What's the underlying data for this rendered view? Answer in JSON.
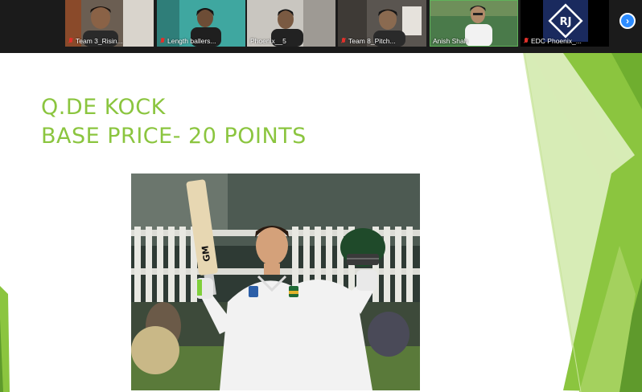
{
  "participants": [
    {
      "name": "Team 3_Risin...",
      "muted": true
    },
    {
      "name": "Length ballers...",
      "muted": true
    },
    {
      "name": "Phoenix__5",
      "muted": false
    },
    {
      "name": "Team 8_Pitch...",
      "muted": true
    },
    {
      "name": "Anish Shah",
      "muted": false,
      "active": true
    },
    {
      "name": "EDC Phoenix_...",
      "muted": true,
      "logo_text": "RJ"
    }
  ],
  "nav": {
    "next_icon": "chevron-right-icon"
  },
  "slide": {
    "title_line1": "Q.DE KOCK",
    "title_line2": "BASE PRICE- 20 POINTS",
    "bat_brand": "GM",
    "accent_color": "#8bc53f"
  }
}
